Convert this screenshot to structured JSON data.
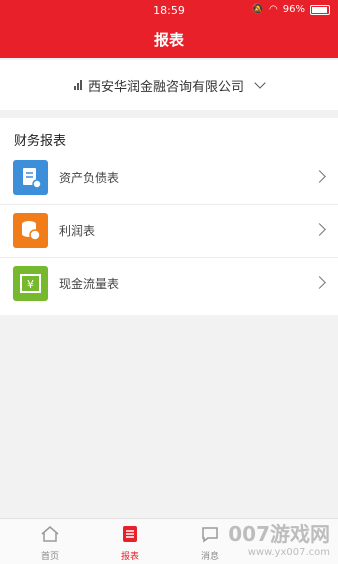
{
  "status_bar": {
    "time": "18:59",
    "battery": "96%"
  },
  "header": {
    "title": "报表"
  },
  "company": {
    "name": "西安华润金融咨询有限公司"
  },
  "section": {
    "title": "财务报表",
    "items": [
      {
        "label": "资产负债表",
        "icon": "balance-sheet-icon",
        "color": "#3d8fd9"
      },
      {
        "label": "利润表",
        "icon": "profit-icon",
        "color": "#f07d1a"
      },
      {
        "label": "现金流量表",
        "icon": "cash-flow-icon",
        "color": "#76b82e"
      }
    ]
  },
  "tabbar": {
    "tabs": [
      {
        "label": "首页"
      },
      {
        "label": "报表"
      },
      {
        "label": "消息"
      }
    ]
  },
  "watermark": {
    "line1": "007游戏网",
    "line2": "www.yx007.com"
  },
  "colors": {
    "accent": "#e8202a"
  }
}
